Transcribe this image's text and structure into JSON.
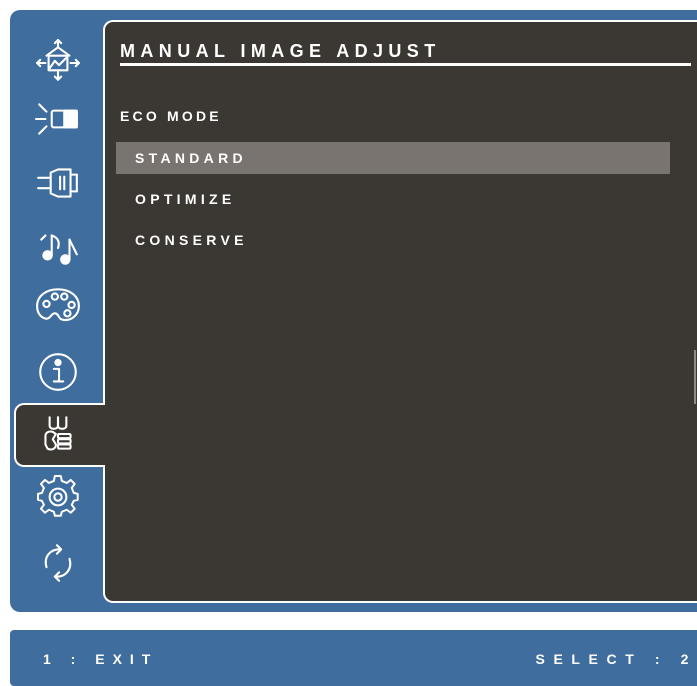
{
  "menu": {
    "title": "MANUAL IMAGE ADJUST",
    "section": "ECO MODE",
    "options": [
      "STANDARD",
      "OPTIMIZE",
      "CONSERVE"
    ],
    "highlighted_option": "STANDARD"
  },
  "sidebar": {
    "icons": [
      "input-select-icon",
      "brightness-contrast-icon",
      "connector-icon",
      "audio-icon",
      "color-palette-icon",
      "information-icon",
      "manual-image-adjust-icon",
      "setup-gear-icon",
      "memory-recall-icon"
    ],
    "selected_icon": "manual-image-adjust-icon"
  },
  "footer": {
    "left": "1 : EXIT",
    "right": "SELECT : 2"
  },
  "colors": {
    "frame_blue": "#3f6d9d",
    "panel_dark": "#3b3733",
    "highlight": "#7a7470",
    "text": "#ffffff"
  }
}
